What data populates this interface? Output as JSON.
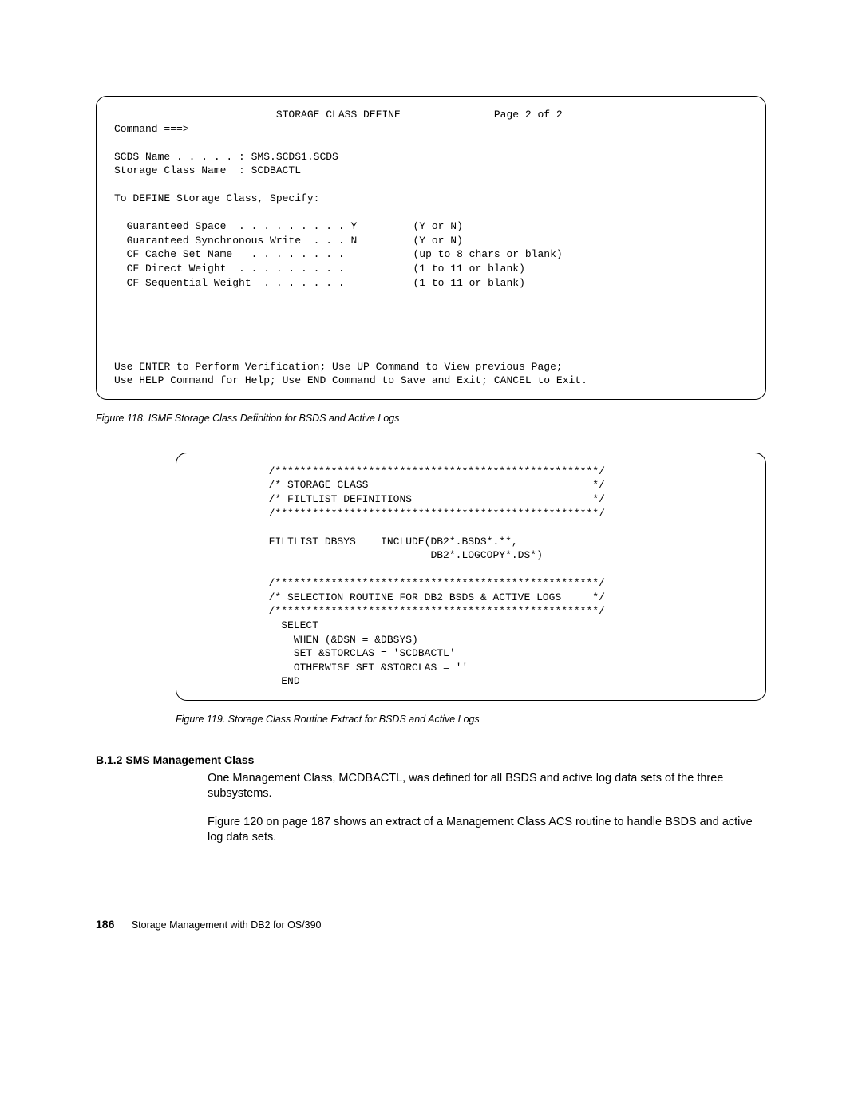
{
  "terminal1": {
    "title_line": "                          STORAGE CLASS DEFINE               Page 2 of 2",
    "cmd": "Command ===>",
    "blank": "",
    "scds": "SCDS Name . . . . . : SMS.SCDS1.SCDS",
    "scn": "Storage Class Name  : SCDBACTL",
    "define_hdr": "To DEFINE Storage Class, Specify:",
    "gs": "  Guaranteed Space  . . . . . . . . . Y         (Y or N)",
    "gsw": "  Guaranteed Synchronous Write  . . . N         (Y or N)",
    "cfn": "  CF Cache Set Name   . . . . . . . .           (up to 8 chars or blank)",
    "cfd": "  CF Direct Weight  . . . . . . . . .           (1 to 11 or blank)",
    "cfs": "  CF Sequential Weight  . . . . . . .           (1 to 11 or blank)",
    "foot1": "Use ENTER to Perform Verification; Use UP Command to View previous Page;",
    "foot2": "Use HELP Command for Help; Use END Command to Save and Exit; CANCEL to Exit."
  },
  "caption1": "Figure 118. ISMF Storage Class Definition for BSDS and Active Logs",
  "terminal2": {
    "l1": "            /****************************************************/",
    "l2": "            /* STORAGE CLASS                                    */",
    "l3": "            /* FILTLIST DEFINITIONS                             */",
    "l4": "            /****************************************************/",
    "blank": "",
    "l5": "            FILTLIST DBSYS    INCLUDE(DB2*.BSDS*.**,",
    "l6": "                                      DB2*.LOGCOPY*.DS*)",
    "l7": "            /****************************************************/",
    "l8": "            /* SELECTION ROUTINE FOR DB2 BSDS & ACTIVE LOGS     */",
    "l9": "            /****************************************************/",
    "l10": "              SELECT",
    "l11": "                WHEN (&DSN = &DBSYS)",
    "l12": "                SET &STORCLAS = 'SCDBACTL'",
    "l13": "                OTHERWISE SET &STORCLAS = ''",
    "l14": "              END"
  },
  "caption2": "Figure 119. Storage Class Routine Extract for BSDS and Active Logs",
  "section_heading": "B.1.2  SMS Management Class",
  "para1": "One Management Class, MCDBACTL, was defined for all BSDS and active log data sets of the three subsystems.",
  "para2": "Figure 120 on page 187 shows an extract of a Management Class ACS routine to handle BSDS and active log data sets.",
  "footer_page": "186",
  "footer_title": "Storage Management with DB2 for OS/390"
}
